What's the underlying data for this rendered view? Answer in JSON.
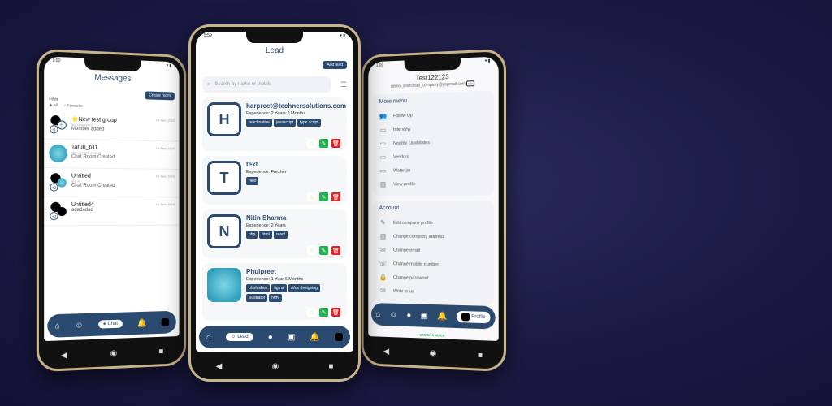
{
  "left": {
    "status_time": "1:00",
    "title": "Messages",
    "create_label": "Create room",
    "filter_label": "Filter",
    "filter_all": "All",
    "filter_fav": "Favourite",
    "chats": [
      {
        "name": "⭐New test group",
        "sub": "test description",
        "msg": "Member added",
        "date": "06 Feb, 2024",
        "badge": "H",
        "count": "+1"
      },
      {
        "name": "Tarun_b11",
        "sub": "Hello, check content",
        "msg": "Chat Room Created",
        "date": "04 Feb, 2024",
        "badge": "",
        "count": ""
      },
      {
        "name": "Untitled",
        "sub": "test 4",
        "msg": "Chat Room Created",
        "date": "02 Feb, 2024",
        "badge": "",
        "count": "+2"
      },
      {
        "name": "Untitled4",
        "sub": "",
        "msg": "adadadad",
        "date": "02 Feb, 2024",
        "badge": "",
        "count": "+2"
      }
    ],
    "nav_active": "Chat"
  },
  "middle": {
    "status_time": "5:59",
    "title": "Lead",
    "add_label": "Add lead",
    "search_placeholder": "Search by name or mobile",
    "leads": [
      {
        "initial": "H",
        "name": "harpreet@technersolutions.com",
        "exp": "Experience: 2 Years 2 Months",
        "tags": [
          "react native",
          "javascript",
          "type script"
        ]
      },
      {
        "initial": "T",
        "name": "text",
        "exp": "Experience: Fresher",
        "tags": [
          "helo"
        ]
      },
      {
        "initial": "N",
        "name": "Nitin Sharma",
        "exp": "Experience: 2 Years",
        "tags": [
          "php",
          "html",
          "react"
        ]
      },
      {
        "initial": "",
        "name": "Phulpreet",
        "exp": "Experience: 1 Year 6 Months",
        "tags": [
          "photoshop",
          "figma",
          "ui/ux designing",
          "illustrator",
          "html"
        ]
      }
    ],
    "nav_active": "Lead"
  },
  "right": {
    "status_time": "1:00",
    "name": "Test122123",
    "email": "demo_searchsta_company@yopmail.com",
    "more_menu_title": "More menu",
    "more_menu": [
      "Follow Up",
      "Interview",
      "Nearby candidates",
      "Vendors",
      "Water jar",
      "View profile"
    ],
    "account_title": "Account",
    "account": [
      "Edit company profile",
      "Change company address",
      "Change email",
      "Change mobile number",
      "Change password",
      "Write to us"
    ],
    "nav_active": "Profile",
    "footer_text": "STAGING BUILD"
  },
  "colors": {
    "navy": "#2b4a6f",
    "green": "#21b14b",
    "red": "#e02424",
    "star": "#f2c94c"
  }
}
